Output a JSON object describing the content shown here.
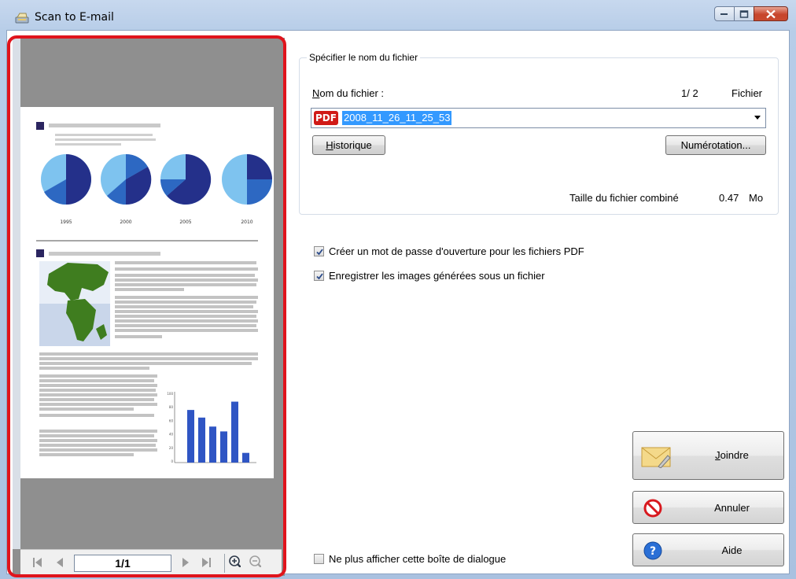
{
  "window": {
    "title": "Scan to E-mail",
    "icon": "scanner-mail-icon"
  },
  "preview": {
    "page_indicator": "1/1",
    "thumbnail": {
      "pie_years": [
        "1995",
        "2000",
        "2005",
        "2010"
      ],
      "bar_values": [
        76,
        65,
        52,
        45,
        88,
        14
      ],
      "bar_axis_ticks": [
        "100",
        "80",
        "60",
        "40",
        "20",
        "0"
      ]
    },
    "toolbar_icons": [
      "first-page-icon",
      "previous-page-icon",
      "next-page-icon",
      "last-page-icon",
      "zoom-in-icon",
      "zoom-out-icon"
    ]
  },
  "file_group": {
    "legend": "Spécifier le nom du fichier",
    "filename_label": "Nom du fichier :",
    "page_count": "1/ 2",
    "unit_label": "Fichier",
    "format_badge": "PDF",
    "filename_value": "2008_11_26_11_25_53",
    "history_button": "Historique",
    "numbering_button": "Numérotation...",
    "combined_size_label": "Taille du fichier combiné",
    "combined_size_value": "0.47",
    "combined_size_unit": "Mo"
  },
  "options": {
    "pdf_password": {
      "label": "Créer un mot de passe d'ouverture pour les fichiers PDF",
      "checked": true
    },
    "single_file": {
      "label": "Enregistrer les images générées sous un fichier",
      "checked": true
    },
    "dont_show": {
      "label": "Ne plus afficher cette boîte de dialogue",
      "checked": false
    }
  },
  "actions": {
    "attach": "Joindre",
    "cancel": "Annuler",
    "help": "Aide"
  },
  "colors": {
    "highlight_outline": "#e0141c",
    "pdf_badge": "#d01a17",
    "selection": "#3399ff"
  }
}
